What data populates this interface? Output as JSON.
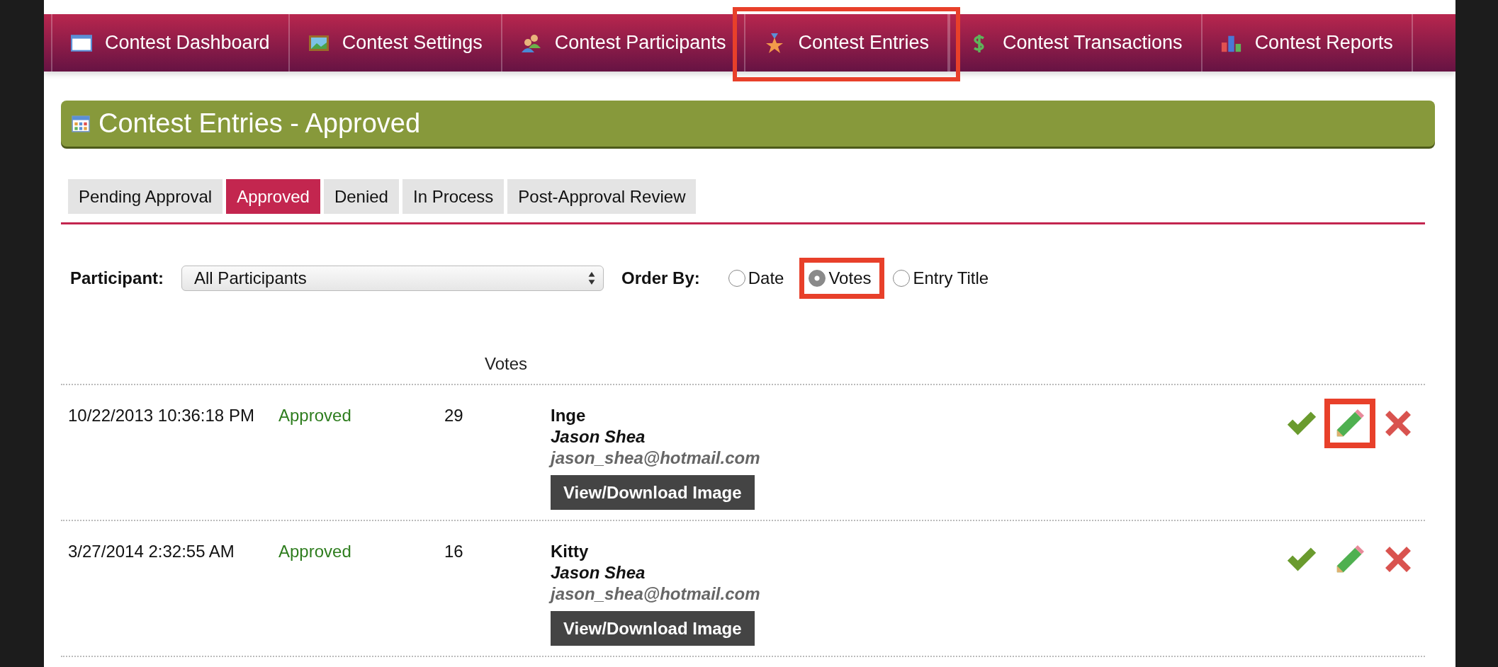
{
  "nav_tabs": [
    {
      "label": "Contest Dashboard",
      "highlighted": false
    },
    {
      "label": "Contest Settings",
      "highlighted": false
    },
    {
      "label": "Contest Participants",
      "highlighted": false
    },
    {
      "label": "Contest Entries",
      "highlighted": true
    },
    {
      "label": "Contest Transactions",
      "highlighted": false
    },
    {
      "label": "Contest Reports",
      "highlighted": false
    }
  ],
  "page_title": "Contest Entries - Approved",
  "status_tabs": [
    {
      "label": "Pending Approval",
      "selected": false
    },
    {
      "label": "Approved",
      "selected": true
    },
    {
      "label": "Denied",
      "selected": false
    },
    {
      "label": "In Process",
      "selected": false
    },
    {
      "label": "Post-Approval Review",
      "selected": false
    }
  ],
  "filter": {
    "participant_label": "Participant:",
    "participant_value": "All Participants",
    "order_label": "Order By:",
    "order_options": [
      {
        "label": "Date",
        "selected": false,
        "highlighted": false
      },
      {
        "label": "Votes",
        "selected": true,
        "highlighted": true
      },
      {
        "label": "Entry Title",
        "selected": false,
        "highlighted": false
      }
    ]
  },
  "table": {
    "votes_header": "Votes",
    "rows": [
      {
        "date": "10/22/2013 10:36:18 PM",
        "status": "Approved",
        "votes": "29",
        "title": "Inge",
        "participant": "Jason Shea",
        "email": "jason_shea@hotmail.com",
        "button": "View/Download Image",
        "actions": [
          {
            "kind": "approve",
            "highlighted": false
          },
          {
            "kind": "edit",
            "highlighted": true
          },
          {
            "kind": "deny",
            "highlighted": false
          }
        ]
      },
      {
        "date": "3/27/2014 2:32:55 AM",
        "status": "Approved",
        "votes": "16",
        "title": "Kitty",
        "participant": "Jason Shea",
        "email": "jason_shea@hotmail.com",
        "button": "View/Download Image",
        "actions": [
          {
            "kind": "approve",
            "highlighted": false
          },
          {
            "kind": "edit",
            "highlighted": false
          },
          {
            "kind": "deny",
            "highlighted": false
          }
        ]
      }
    ]
  }
}
